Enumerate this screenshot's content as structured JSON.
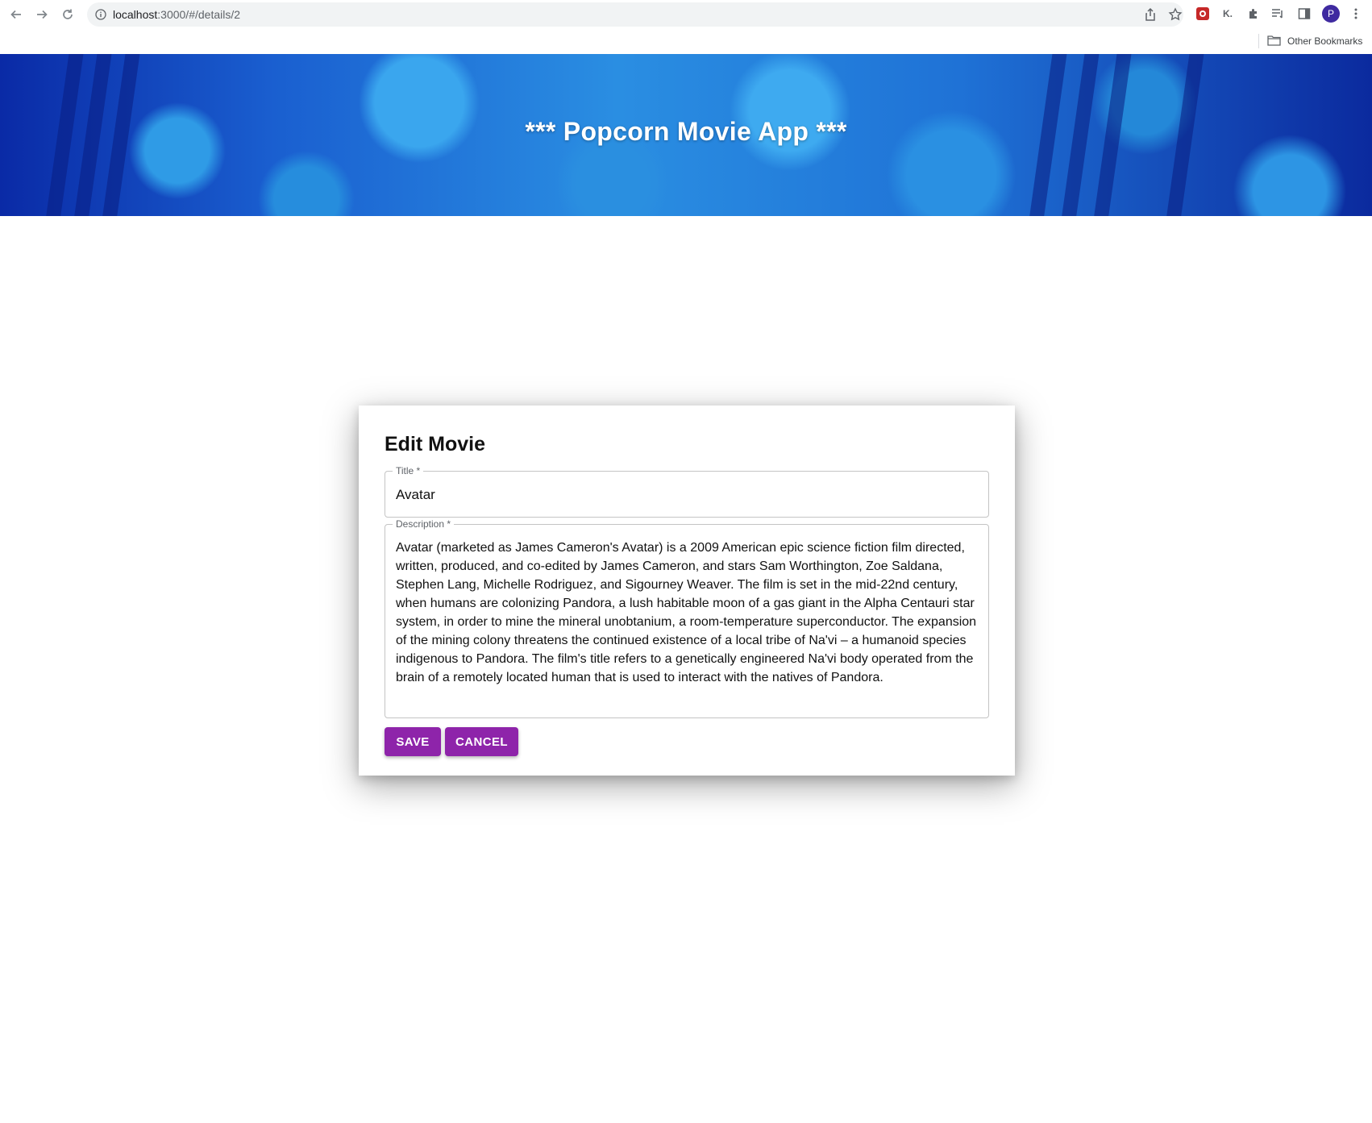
{
  "browser": {
    "url_host": "localhost",
    "url_rest": ":3000/#/details/2",
    "profile_initial": "P",
    "extension_k_label": "K.",
    "bookmarks_other": "Other Bookmarks"
  },
  "header": {
    "title": "*** Popcorn Movie App ***"
  },
  "form": {
    "heading": "Edit Movie",
    "title_label": "Title *",
    "title_value": "Avatar",
    "description_label": "Description *",
    "description_value": "Avatar (marketed as James Cameron's Avatar) is a 2009 American epic science fiction film directed, written, produced, and co-edited by James Cameron, and stars Sam Worthington, Zoe Saldana, Stephen Lang, Michelle Rodriguez, and Sigourney Weaver. The film is set in the mid-22nd century, when humans are colonizing Pandora, a lush habitable moon of a gas giant in the Alpha Centauri star system, in order to mine the mineral unobtanium, a room-temperature superconductor. The expansion of the mining colony threatens the continued existence of a local tribe of Na'vi – a humanoid species indigenous to Pandora. The film's title refers to a genetically engineered Na'vi body operated from the brain of a remotely located human that is used to interact with the natives of Pandora.",
    "save_label": "SAVE",
    "cancel_label": "CANCEL"
  },
  "colors": {
    "button": "#8e24aa",
    "banner": "#1a5fd0"
  }
}
